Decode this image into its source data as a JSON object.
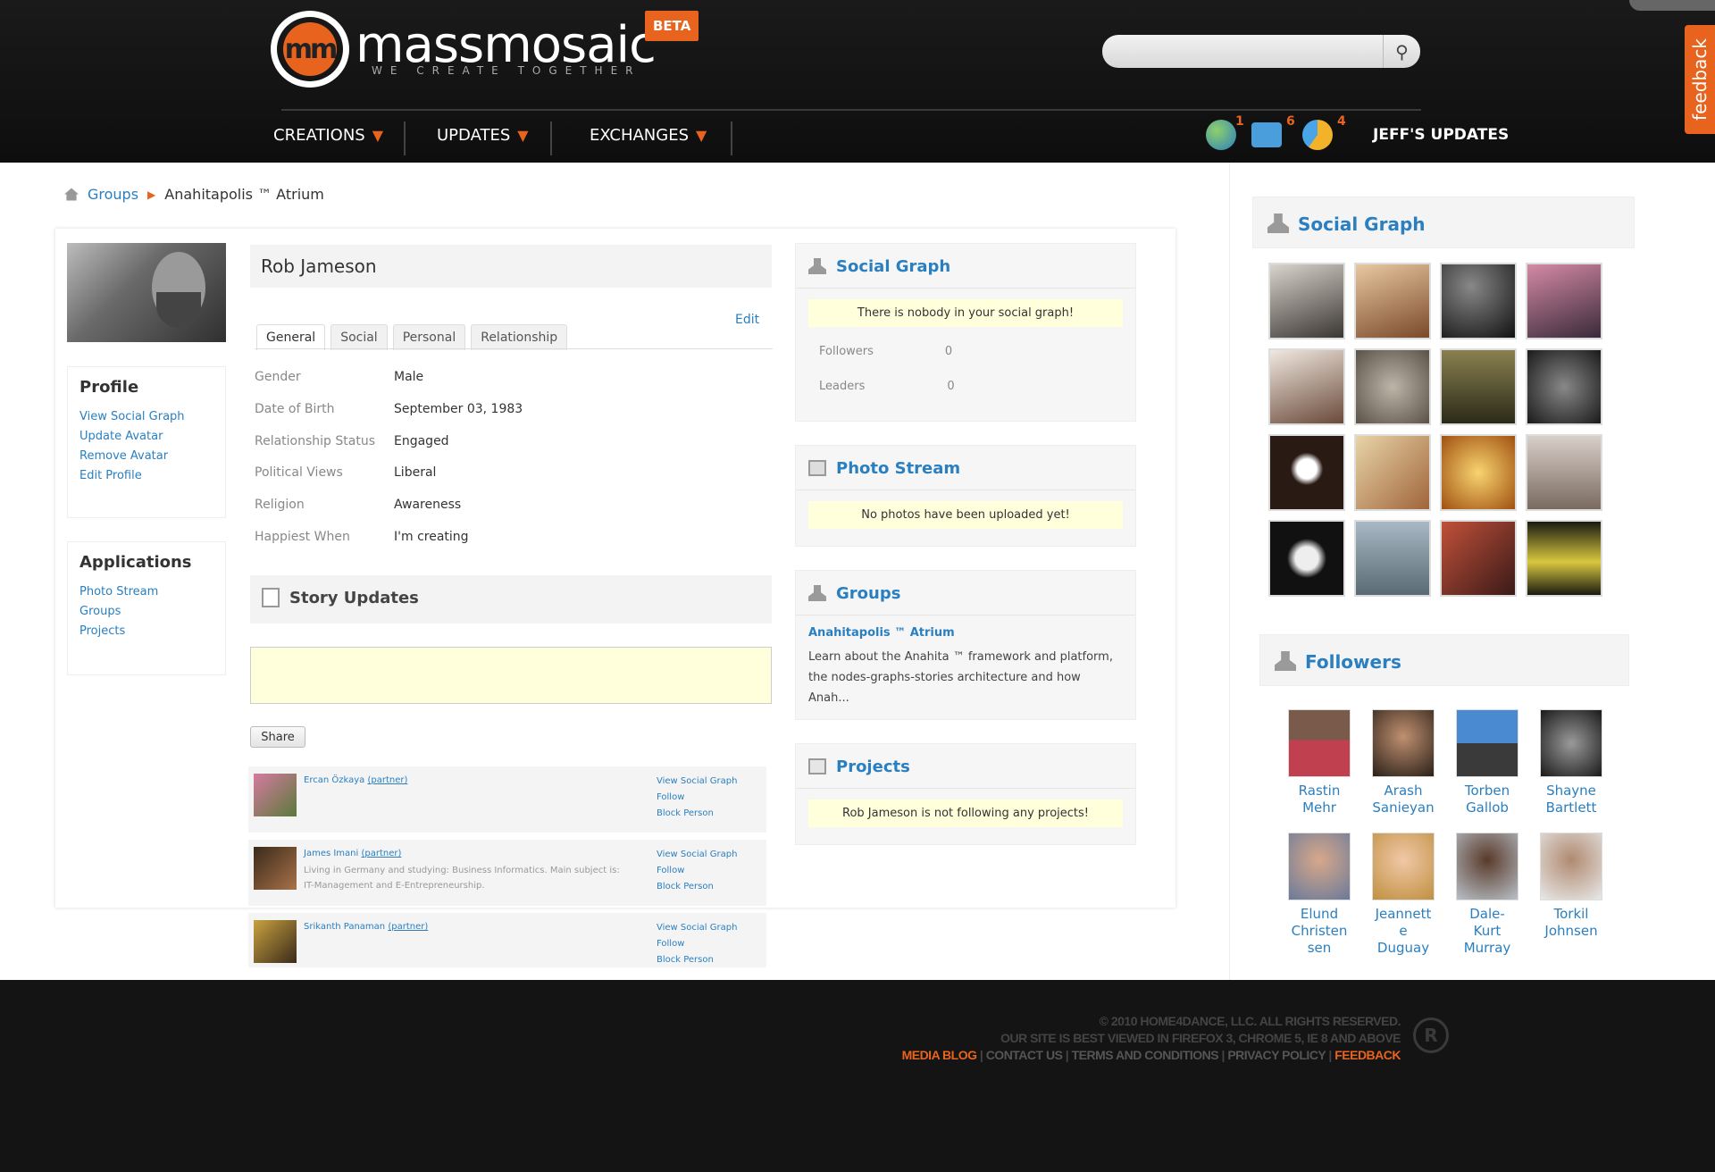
{
  "brand": {
    "name": "massmosaic",
    "tagline": "WE CREATE TOGETHER",
    "badge": "BETA",
    "logo_text": "mm",
    "accent": "#e8641e"
  },
  "search": {
    "placeholder": "",
    "icon": "search-icon"
  },
  "nav": {
    "items": [
      {
        "label": "CREATIONS"
      },
      {
        "label": "UPDATES"
      },
      {
        "label": "EXCHANGES"
      }
    ],
    "notifications": [
      {
        "icon": "globe-icon",
        "count": "1"
      },
      {
        "icon": "chat-bubble-icon",
        "count": "6"
      },
      {
        "icon": "pie-chart-icon",
        "count": "4"
      }
    ],
    "user_updates": "JEFF'S UPDATES"
  },
  "feedback_tab": "feedback",
  "breadcrumb": {
    "link": "Groups",
    "current": "Anahitapolis ™ Atrium"
  },
  "profile": {
    "name": "Rob Jameson",
    "edit": "Edit",
    "tabs": [
      "General",
      "Social",
      "Personal",
      "Relationship"
    ],
    "fields": [
      {
        "label": "Gender",
        "value": "Male"
      },
      {
        "label": "Date of Birth",
        "value": "September 03, 1983"
      },
      {
        "label": "Relationship Status",
        "value": "Engaged"
      },
      {
        "label": "Political Views",
        "value": "Liberal"
      },
      {
        "label": "Religion",
        "value": "Awareness"
      },
      {
        "label": "Happiest When",
        "value": "I'm creating"
      }
    ]
  },
  "sidebar": {
    "profile_title": "Profile",
    "profile_links": [
      "View Social Graph",
      "Update Avatar",
      "Remove Avatar",
      "Edit Profile"
    ],
    "apps_title": "Applications",
    "app_links": [
      "Photo Stream",
      "Groups",
      "Projects"
    ]
  },
  "story": {
    "title": "Story Updates",
    "share": "Share",
    "items": [
      {
        "name": "Ercan Özkaya",
        "tag": "(partner)",
        "desc": "",
        "actions": [
          "View Social Graph",
          "Follow",
          "Block Person"
        ]
      },
      {
        "name": "James Imani",
        "tag": "(partner)",
        "desc": "Living in Germany and studying: Business Informatics. Main subject is: IT-Management and E-Entrepreneurship.",
        "actions": [
          "View Social Graph",
          "Follow",
          "Block Person"
        ]
      },
      {
        "name": "Srikanth Panaman",
        "tag": "(partner)",
        "desc": "",
        "actions": [
          "View Social Graph",
          "Follow",
          "Block Person"
        ]
      }
    ]
  },
  "widgets": {
    "social_graph": {
      "title": "Social Graph",
      "notice": "There is nobody in your social graph!",
      "followers_label": "Followers",
      "followers_count": "0",
      "leaders_label": "Leaders",
      "leaders_count": "0"
    },
    "photo_stream": {
      "title": "Photo Stream",
      "notice": "No photos have been uploaded yet!"
    },
    "groups": {
      "title": "Groups",
      "group_name": "Anahitapolis ™ Atrium",
      "group_desc": "Learn about the Anahita ™ framework and platform, the nodes-graphs-stories architecture and how Anah..."
    },
    "projects": {
      "title": "Projects",
      "notice": "Rob Jameson is not following any projects!"
    }
  },
  "right": {
    "social_graph_title": "Social Graph",
    "followers_title": "Followers",
    "followers": [
      {
        "name": "Rastin Mehr"
      },
      {
        "name": "Arash Sanieyan"
      },
      {
        "name": "Torben Gallob"
      },
      {
        "name": "Shayne Bartlett"
      },
      {
        "name": "Elund Christen sen"
      },
      {
        "name": "Jeannette Duguay"
      },
      {
        "name": "Dale-Kurt Murray"
      },
      {
        "name": "Torkil Johnsen"
      }
    ]
  },
  "footer": {
    "copyright": "© 2010 HOME4DANCE, LLC. ALL RIGHTS RESERVED.",
    "browsers": "OUR SITE IS BEST VIEWED IN FIREFOX 3, CHROME 5, IE 8 AND ABOVE",
    "links": [
      "MEDIA BLOG",
      "CONTACT US",
      "TERMS AND CONDITIONS",
      "PRIVACY POLICY",
      "FEEDBACK"
    ],
    "registered": "R"
  }
}
